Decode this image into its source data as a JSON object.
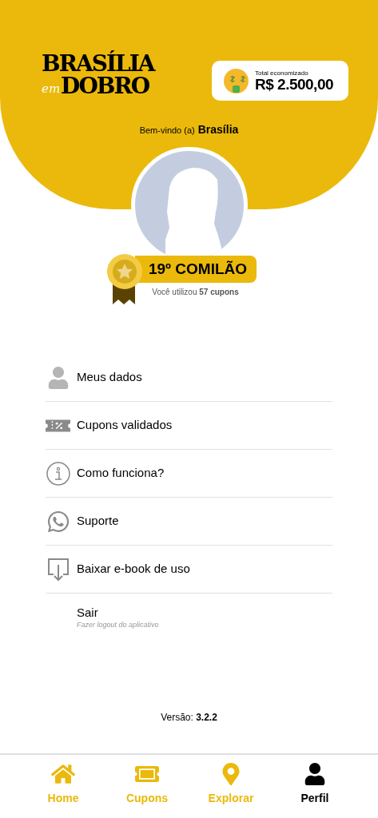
{
  "logo": {
    "line_1": "BRASÍLIA",
    "script_word": "em",
    "line_2": "DOBRO"
  },
  "savings": {
    "label": "Total economizado",
    "value": "R$ 2.500,00"
  },
  "welcome": {
    "prefix": "Bem-vindo (a)",
    "name": "Brasília"
  },
  "rank": {
    "title": "19º COMILÃO",
    "usage": "Você utilizou **57 cupons**"
  },
  "menu": [
    {
      "kind": "user",
      "label": "Meus dados"
    },
    {
      "kind": "ticket",
      "label": "Cupons validados"
    },
    {
      "kind": "info",
      "label": "Como funciona?"
    },
    {
      "kind": "whatsapp",
      "label": "Suporte"
    },
    {
      "kind": "download",
      "label": "Baixar e-book de uso"
    },
    {
      "kind": "plain",
      "label": "Sair",
      "subtitle": "Fazer logout do aplicativo"
    }
  ],
  "version": "Versão: **3.2.2**",
  "nav": [
    {
      "kind": "home",
      "label": "Home",
      "selected": false
    },
    {
      "kind": "ticket",
      "label": "Cupons",
      "selected": false
    },
    {
      "kind": "pin",
      "label": "Explorar",
      "selected": false
    },
    {
      "kind": "user",
      "label": "Perfil",
      "selected": true
    }
  ]
}
